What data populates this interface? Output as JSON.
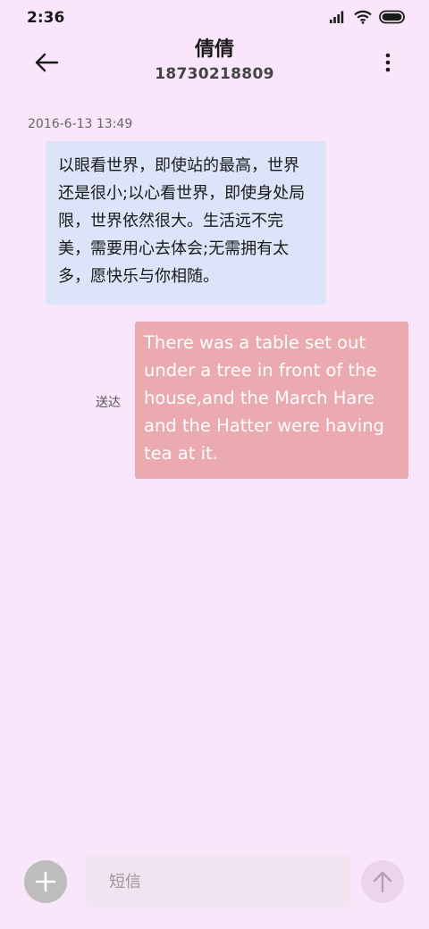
{
  "status_bar": {
    "time": "2:36"
  },
  "header": {
    "back_icon": "arrow-left-icon",
    "contact_name": "倩倩",
    "contact_number": "18730218809",
    "more_icon": "more-vertical-icon"
  },
  "conversation": {
    "timestamp": "2016-6-13 13:49",
    "messages": [
      {
        "direction": "incoming",
        "text": "以眼看世界，即使站的最高，世界还是很小;以心看世界，即使身处局限，世界依然很大。生活远不完美，需要用心去体会;无需拥有太多，愿快乐与你相随。"
      },
      {
        "direction": "outgoing",
        "text": "There was a table set out under a tree in front of the house,and the March Hare and the Hatter were having tea at it.",
        "status": "送达"
      }
    ]
  },
  "composer": {
    "add_icon": "plus-icon",
    "placeholder": "短信",
    "send_icon": "arrow-up-icon"
  },
  "colors": {
    "background": "#fae6fb",
    "incoming_bubble": "#dbe4f8",
    "outgoing_bubble": "#eba9b0",
    "add_button": "#bdbdbd",
    "send_button": "#ecd5ec"
  }
}
